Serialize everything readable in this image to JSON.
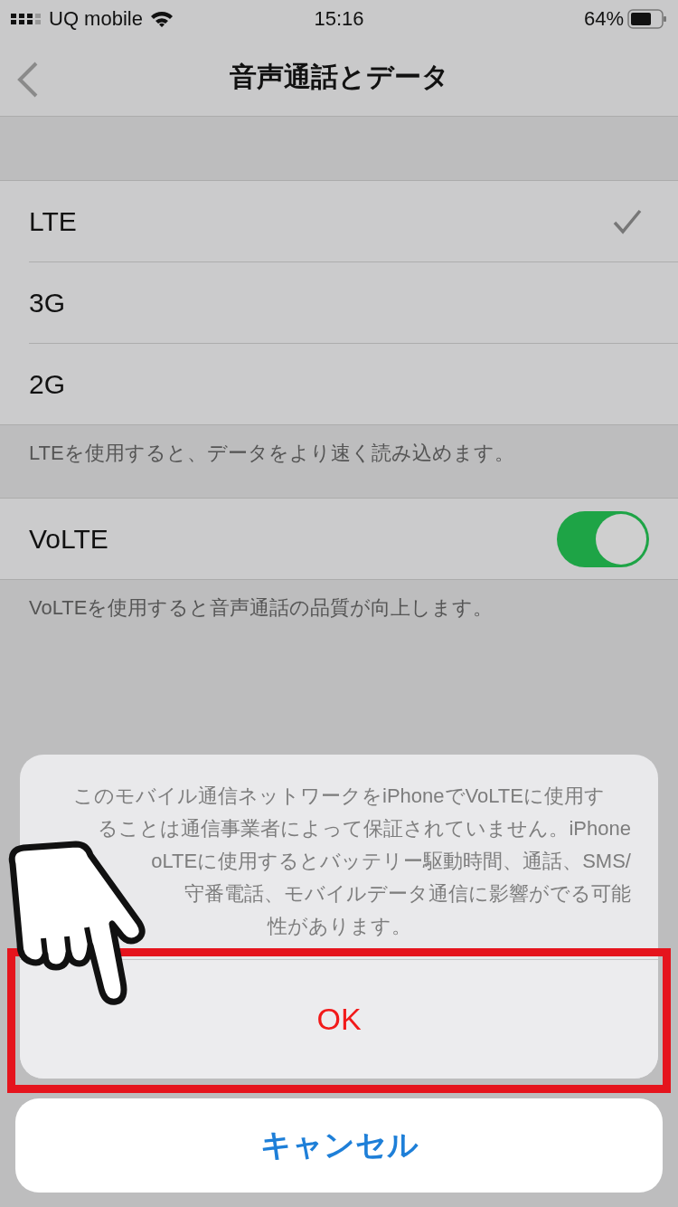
{
  "status_bar": {
    "carrier": "UQ mobile",
    "time": "15:16",
    "battery": "64%"
  },
  "nav": {
    "title": "音声通話とデータ"
  },
  "network_options": [
    {
      "label": "LTE",
      "selected": true
    },
    {
      "label": "3G",
      "selected": false
    },
    {
      "label": "2G",
      "selected": false
    }
  ],
  "network_footer": "LTEを使用すると、データをより速く読み込めます。",
  "volte": {
    "label": "VoLTE",
    "on": true
  },
  "volte_footer": "VoLTEを使用すると音声通話の品質が向上します。",
  "alert": {
    "message_lines": [
      "このモバイル通信ネットワークをiPhoneでVoLTEに使用す",
      "ることは通信事業者によって保証されていません。iPhone",
      "oLTEに使用するとバッテリー駆動時間、通話、SMS/",
      "守番電話、モバイルデータ通信に影響がでる可能",
      "性があります。"
    ],
    "ok": "OK",
    "cancel": "キャンセル"
  }
}
